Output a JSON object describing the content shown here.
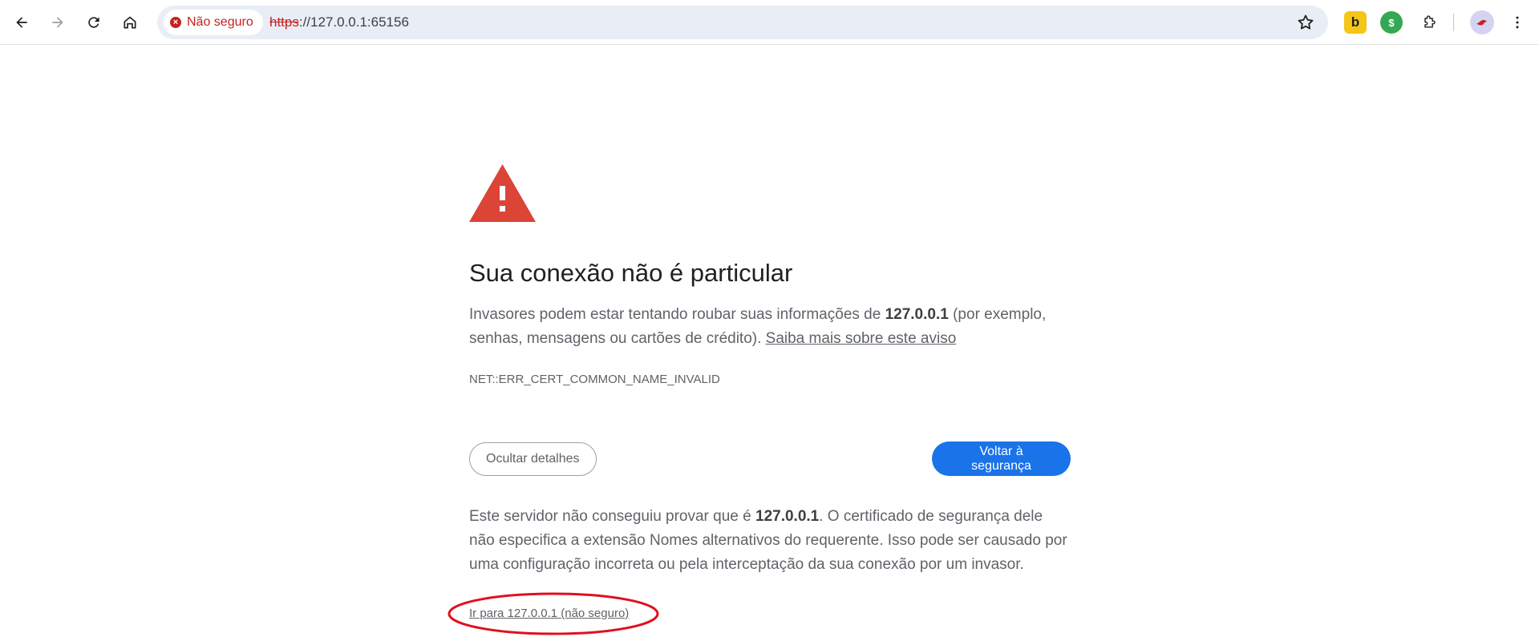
{
  "browser": {
    "security_chip": "Não seguro",
    "url_scheme": "https",
    "url_rest": "://127.0.0.1:65156",
    "icons": [
      "back-icon",
      "forward-icon",
      "reload-icon",
      "home-icon",
      "bookmark-star-icon",
      "extensions-icon",
      "more-menu-icon"
    ],
    "extensions": [
      {
        "name": "b-extension",
        "glyph": "b",
        "bg": "#f5c518",
        "fg": "#1f1f1f"
      },
      {
        "name": "green-extension",
        "glyph": "$",
        "bg": "#34a853",
        "fg": "#ffffff"
      }
    ]
  },
  "page": {
    "heading": "Sua conexão não é particular",
    "intro_prefix": "Invasores podem estar tentando roubar suas informações de ",
    "intro_host": "127.0.0.1",
    "intro_suffix": " (por exemplo, senhas, mensagens ou cartões de crédito). ",
    "learn_more": "Saiba mais sobre este aviso",
    "error_code": "NET::ERR_CERT_COMMON_NAME_INVALID",
    "details_button": "Ocultar detalhes",
    "back_button": "Voltar à segurança",
    "details_prefix": "Este servidor não conseguiu provar que é ",
    "details_host": "127.0.0.1",
    "details_suffix": ". O certificado de segurança dele não especifica a extensão Nomes alternativos do requerente. Isso pode ser causado por uma configuração incorreta ou pela interceptação da sua conexão por um invasor.",
    "proceed_link": "Ir para 127.0.0.1 (não seguro)"
  },
  "colors": {
    "warning_red": "#db4437",
    "primary_blue": "#1a73e8",
    "annotation_red": "#e0101f",
    "not_secure_red": "#c5221f"
  }
}
